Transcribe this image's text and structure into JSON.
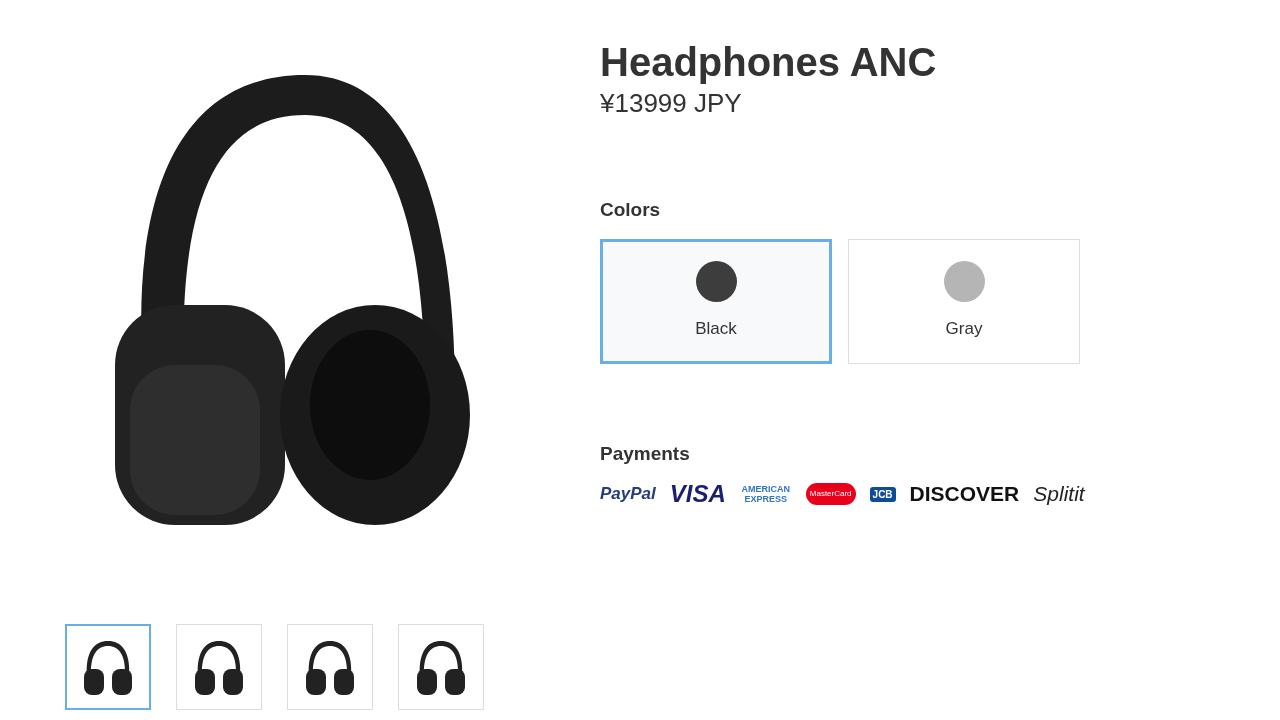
{
  "product": {
    "title": "Headphones ANC",
    "price": "¥13999 JPY"
  },
  "thumbnails": [
    {
      "selected": true
    },
    {
      "selected": false
    },
    {
      "selected": false
    },
    {
      "selected": false
    }
  ],
  "colors": {
    "label": "Colors",
    "options": [
      {
        "name": "Black",
        "color": "#3d3d3d",
        "selected": true
      },
      {
        "name": "Gray",
        "color": "#b5b5b5",
        "selected": false
      }
    ]
  },
  "payments": {
    "label": "Payments",
    "methods": [
      {
        "kind": "paypal",
        "text": "PayPal"
      },
      {
        "kind": "visa",
        "text": "VISA"
      },
      {
        "kind": "amex",
        "text": "AMERICAN EXPRESS"
      },
      {
        "kind": "mastercard",
        "text": "MasterCard"
      },
      {
        "kind": "jcb",
        "text": "JCB"
      },
      {
        "kind": "discover",
        "text": "DISCOVER"
      },
      {
        "kind": "splitit",
        "text": "Splitit"
      }
    ]
  }
}
